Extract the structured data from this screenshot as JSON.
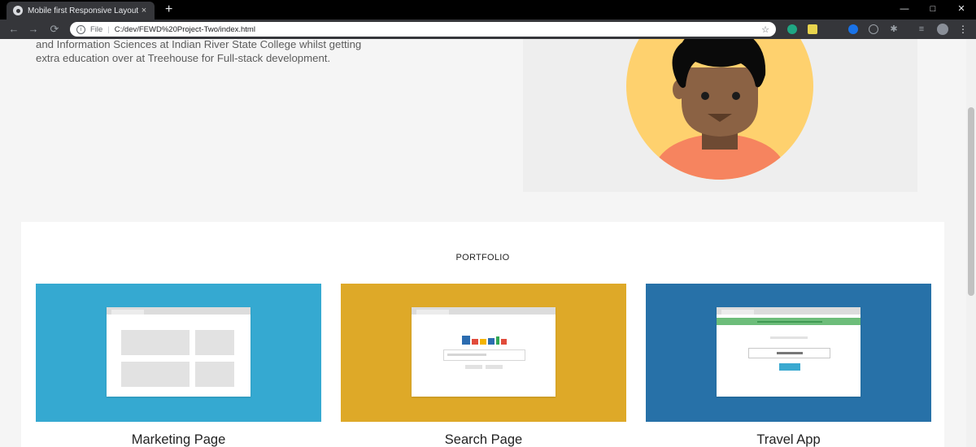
{
  "browser": {
    "tab_title": "Mobile first Responsive Layout",
    "tab_close": "×",
    "new_tab": "+",
    "scheme": "File",
    "separator": "|",
    "url": "C:/dev/FEWD%20Project-Two/index.html",
    "window_controls": [
      "—",
      "□",
      "✕"
    ]
  },
  "about": {
    "line1": "and Information Sciences at Indian River State College whilst getting",
    "line2": "extra education over at Treehouse for Full-stack development."
  },
  "portfolio": {
    "title": "PORTFOLIO",
    "projects": [
      {
        "title": "Marketing Page",
        "color": "#35a9d1"
      },
      {
        "title": "Search Page",
        "color": "#dea928"
      },
      {
        "title": "Travel App",
        "color": "#2771a8"
      }
    ]
  },
  "colors": {
    "avatar_bg": "#fed16e",
    "skin": "#8b6244",
    "hair": "#0a0a0a",
    "shirt": "#f6845f"
  }
}
